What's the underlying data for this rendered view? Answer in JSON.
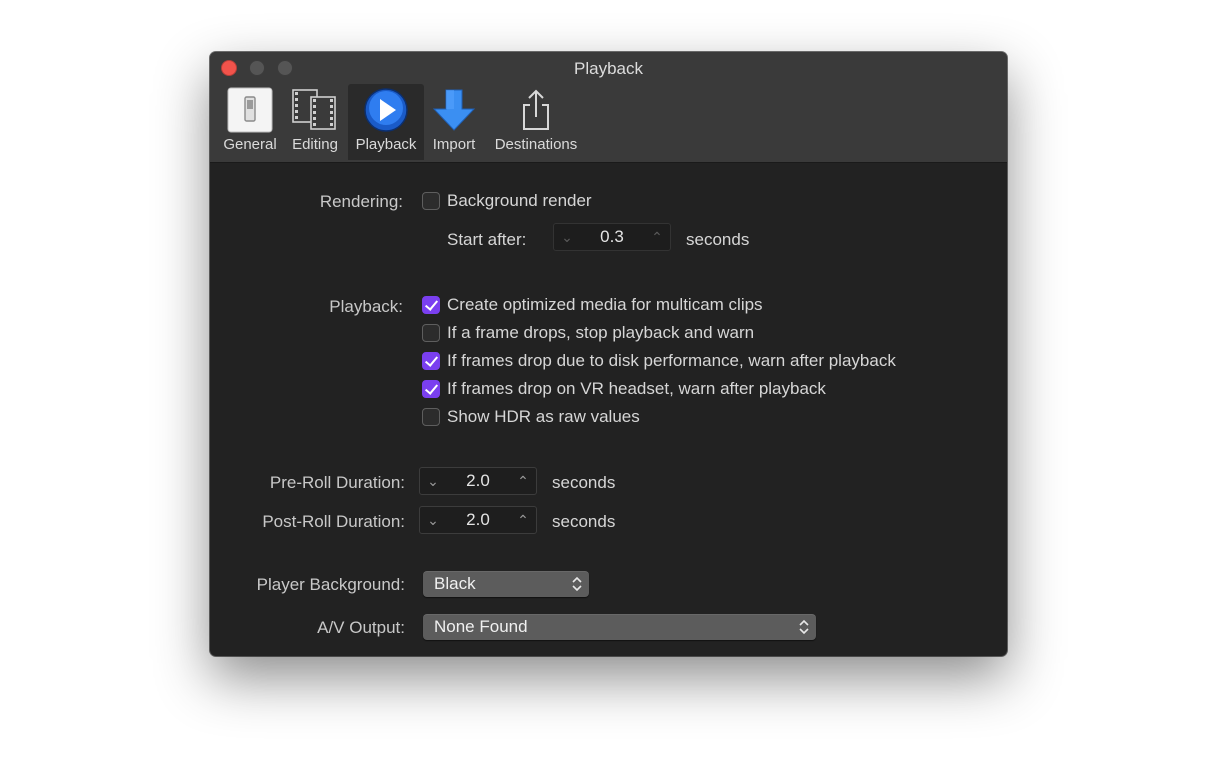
{
  "window": {
    "title": "Playback"
  },
  "toolbar": {
    "tabs": [
      {
        "label": "General",
        "icon": "toggle-switch-icon"
      },
      {
        "label": "Editing",
        "icon": "film-frames-icon"
      },
      {
        "label": "Playback",
        "icon": "play-circle-icon",
        "active": true
      },
      {
        "label": "Import",
        "icon": "down-arrow-icon"
      },
      {
        "label": "Destinations",
        "icon": "share-icon"
      }
    ]
  },
  "rendering": {
    "label": "Rendering:",
    "background_render": {
      "label": "Background render",
      "checked": false
    },
    "start_after": {
      "label": "Start after:",
      "value": "0.3",
      "unit": "seconds"
    }
  },
  "playback": {
    "label": "Playback:",
    "options": [
      {
        "label": "Create optimized media for multicam clips",
        "checked": true
      },
      {
        "label": "If a frame drops, stop playback and warn",
        "checked": false
      },
      {
        "label": "If frames drop due to disk performance, warn after playback",
        "checked": true
      },
      {
        "label": "If frames drop on VR headset, warn after playback",
        "checked": true
      },
      {
        "label": "Show HDR as raw values",
        "checked": false
      }
    ]
  },
  "pre_roll": {
    "label": "Pre-Roll Duration:",
    "value": "2.0",
    "unit": "seconds"
  },
  "post_roll": {
    "label": "Post-Roll Duration:",
    "value": "2.0",
    "unit": "seconds"
  },
  "player_background": {
    "label": "Player Background:",
    "value": "Black"
  },
  "av_output": {
    "label": "A/V Output:",
    "value": "None Found"
  },
  "colors": {
    "accent": "#7a3ff0",
    "close": "#f2534b",
    "play_blue": "#1f6fe0"
  }
}
